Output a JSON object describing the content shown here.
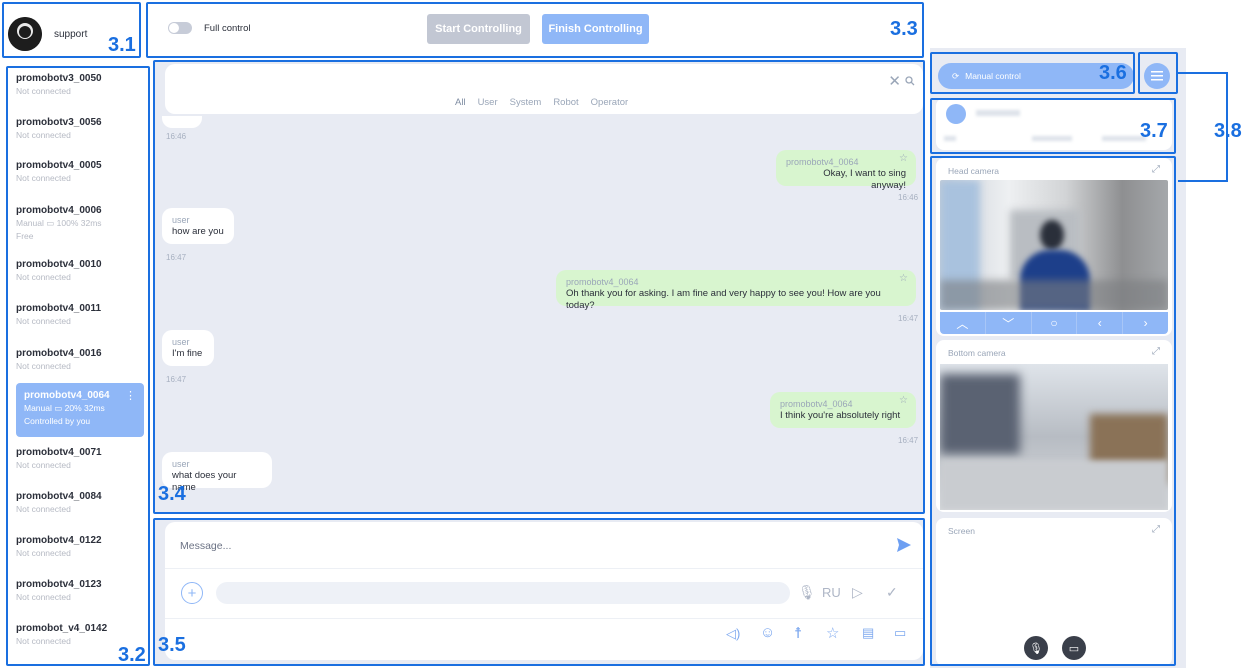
{
  "header": {
    "username": "support",
    "full_control_label": "Full control",
    "start_label": "Start Controlling",
    "finish_label": "Finish Controlling"
  },
  "robots": [
    {
      "name": "promobotv3_0050",
      "status": "Not connected"
    },
    {
      "name": "promobotv3_0056",
      "status": "Not connected"
    },
    {
      "name": "promobotv4_0005",
      "status": "Not connected"
    },
    {
      "name": "promobotv4_0006",
      "status": "Manual  ▭ 100%  32ms",
      "status2": "Free"
    },
    {
      "name": "promobotv4_0010",
      "status": "Not connected"
    },
    {
      "name": "promobotv4_0011",
      "status": "Not connected"
    },
    {
      "name": "promobotv4_0016",
      "status": "Not connected"
    },
    {
      "name": "promobotv4_0064",
      "status": "Manual  ▭ 20%  32ms",
      "status2": "Controlled by you"
    },
    {
      "name": "promobotv4_0071",
      "status": "Not connected"
    },
    {
      "name": "promobotv4_0084",
      "status": "Not connected"
    },
    {
      "name": "promobotv4_0122",
      "status": "Not connected"
    },
    {
      "name": "promobotv4_0123",
      "status": "Not connected"
    },
    {
      "name": "promobot_v4_0142",
      "status": "Not connected"
    }
  ],
  "chat": {
    "filters": [
      "All",
      "User",
      "System",
      "Robot",
      "Operator"
    ],
    "messages": [
      {
        "sender": "promobotv4_0064",
        "text": "Okay, I want to sing anyway!",
        "time": "16:46"
      },
      {
        "sender": "user",
        "text": "how are you",
        "time": "16:47"
      },
      {
        "sender": "promobotv4_0064",
        "text": "Oh thank you for asking. I am fine and very happy to see you! How are you today?",
        "time": "16:47"
      },
      {
        "sender": "user",
        "text": "I'm fine",
        "time": "16:47"
      },
      {
        "sender": "promobotv4_0064",
        "text": "I think you're absolutely right",
        "time": "16:47"
      },
      {
        "sender": "user",
        "text": "what does your name",
        "time": ""
      }
    ],
    "first_time": "16:46"
  },
  "composer": {
    "placeholder": "Message...",
    "lang": "RU"
  },
  "right": {
    "manual_control_label": "Manual control",
    "head_camera_label": "Head camera",
    "bottom_camera_label": "Bottom camera",
    "screen_label": "Screen"
  },
  "callouts": {
    "c31": "3.1",
    "c32": "3.2",
    "c33": "3.3",
    "c34": "3.4",
    "c35": "3.5",
    "c36": "3.6",
    "c37": "3.7",
    "c38": "3.8"
  },
  "colors": {
    "accent": "#8fb7f7",
    "callout": "#1a6fe0",
    "chat_bg": "#e8ebf3",
    "robot_bubble": "#d8f5cf"
  }
}
